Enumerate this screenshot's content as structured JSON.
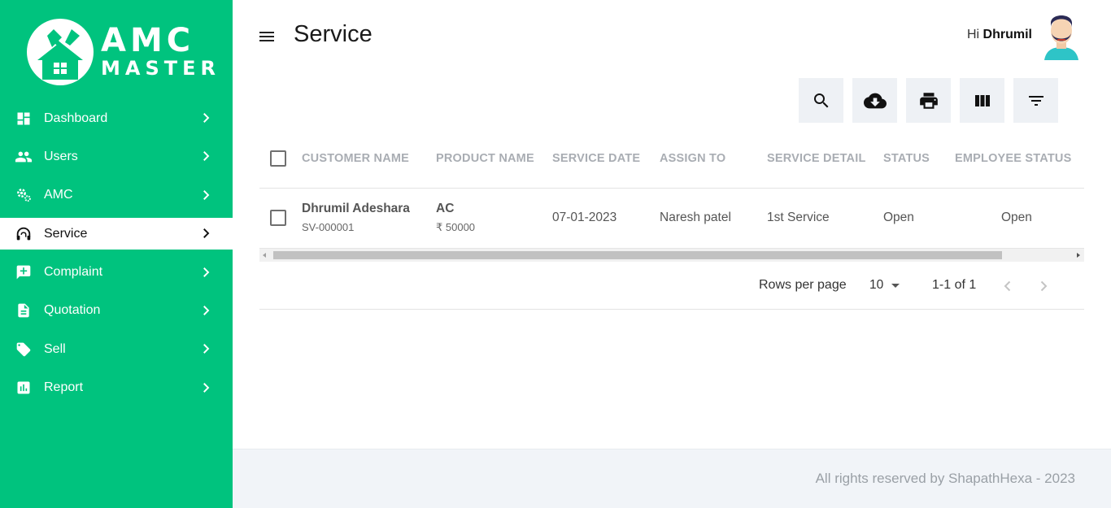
{
  "app": {
    "logo_line1": "AMC",
    "logo_line2": "MASTER",
    "brand_color": "#00c37e"
  },
  "sidebar": {
    "items": [
      {
        "label": "Dashboard",
        "icon": "dashboard-icon",
        "active": false
      },
      {
        "label": "Users",
        "icon": "users-icon",
        "active": false
      },
      {
        "label": "AMC",
        "icon": "gears-icon",
        "active": false
      },
      {
        "label": "Service",
        "icon": "headset-icon",
        "active": true
      },
      {
        "label": "Complaint",
        "icon": "add-comment-icon",
        "active": false
      },
      {
        "label": "Quotation",
        "icon": "document-icon",
        "active": false
      },
      {
        "label": "Sell",
        "icon": "tag-icon",
        "active": false
      },
      {
        "label": "Report",
        "icon": "bar-chart-icon",
        "active": false
      }
    ]
  },
  "header": {
    "title": "Service",
    "greeting_prefix": "Hi",
    "user_name": "Dhrumil"
  },
  "toolbar": {
    "buttons": [
      "search-icon",
      "cloud-download-icon",
      "print-icon",
      "columns-icon",
      "filter-icon"
    ]
  },
  "table": {
    "columns": [
      "CUSTOMER NAME",
      "PRODUCT NAME",
      "SERVICE DATE",
      "ASSIGN TO",
      "SERVICE DETAIL",
      "STATUS",
      "EMPLOYEE STATUS"
    ],
    "rows": [
      {
        "customer_name": "Dhrumil Adeshara",
        "service_id": "SV-000001",
        "product_name": "AC",
        "price": "₹ 50000",
        "service_date": "07-01-2023",
        "assign_to": "Naresh patel",
        "service_detail": "1st Service",
        "status": "Open",
        "employee_status": "Open"
      }
    ]
  },
  "pagination": {
    "rows_per_page_label": "Rows per page",
    "rows_per_page_value": "10",
    "range": "1-1 of 1"
  },
  "footer": {
    "text": "All rights reserved by ShapathHexa - 2023"
  }
}
